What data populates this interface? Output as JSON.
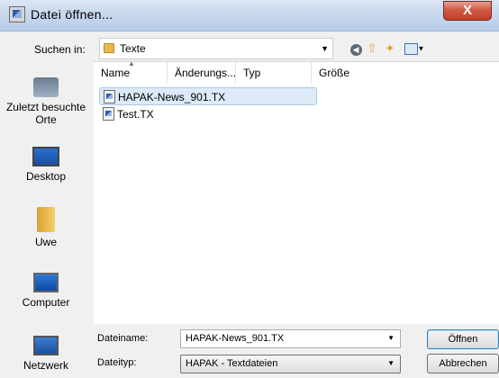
{
  "window": {
    "title": "Datei öffnen...",
    "close_label": "X"
  },
  "lookin": {
    "label": "Suchen in:",
    "value": "Texte"
  },
  "toolbar": {
    "icons": [
      "back-icon",
      "up-folder-icon",
      "new-folder-icon",
      "view-menu-icon"
    ]
  },
  "places": [
    {
      "label": "Zuletzt besuchte Orte",
      "icon": "recent-places-icon"
    },
    {
      "label": "Desktop",
      "icon": "desktop-icon"
    },
    {
      "label": "Uwe",
      "icon": "user-folder-icon"
    },
    {
      "label": "Computer",
      "icon": "computer-icon"
    },
    {
      "label": "Netzwerk",
      "icon": "network-icon"
    }
  ],
  "columns": {
    "name": "Name",
    "modified": "Änderungs...",
    "type": "Typ",
    "size": "Größe"
  },
  "files": [
    {
      "name": "HAPAK-News_901.TX",
      "selected": true
    },
    {
      "name": "Test.TX",
      "selected": false
    }
  ],
  "filename": {
    "label": "Dateiname:",
    "value": "HAPAK-News_901.TX"
  },
  "filetype": {
    "label": "Dateityp:",
    "value": "HAPAK - Textdateien"
  },
  "buttons": {
    "open": "Öffnen",
    "cancel": "Abbrechen"
  },
  "colors": {
    "title_bar": "#c8d8ee",
    "close_button": "#c23d27",
    "selection": "#ddeaf8"
  }
}
